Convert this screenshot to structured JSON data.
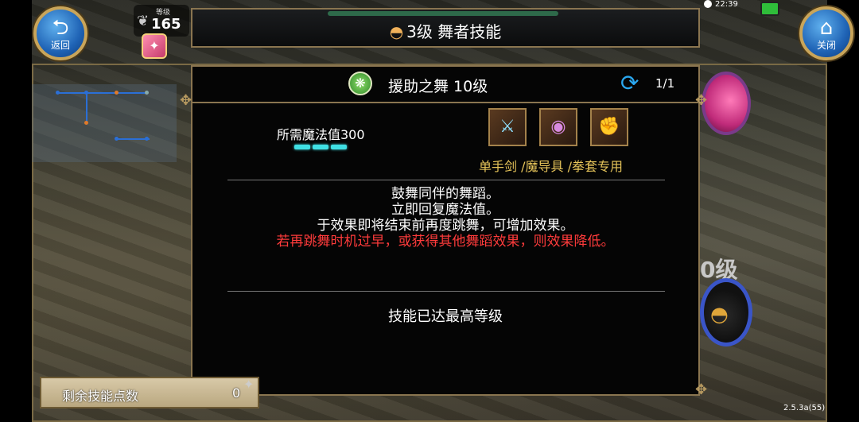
{
  "nav": {
    "back_label": "返回",
    "close_label": "关闭",
    "back_glyph": "⮌",
    "close_glyph": "⌂"
  },
  "player": {
    "level_caption": "等级",
    "level": "165",
    "other_count": "0"
  },
  "header": {
    "title": "3级 舞者技能"
  },
  "status": {
    "time": "22:39"
  },
  "skill": {
    "name": "援助之舞 10级",
    "page": "1/1",
    "mana_label": "所需魔法值300",
    "mana_segments": 3,
    "weapons": [
      "sword-icon",
      "magic-tool-icon",
      "knuckle-icon"
    ],
    "weapon_caption": "单手剑 /魔导具 /拳套专用",
    "description": [
      "鼓舞同伴的舞蹈。",
      "立即回复魔法值。",
      "于效果即将结束前再度跳舞，可增加效果。"
    ],
    "warning": "若再跳舞时机过早，或获得其他舞蹈效果，则效果降低。",
    "maxed_text": "技能已达最高等级"
  },
  "side": {
    "level_text": "0级"
  },
  "skill_points": {
    "label": "剩余技能点数",
    "value": "0"
  },
  "footer": {
    "version": "2.5.3a(55)"
  },
  "colors": {
    "warning": "#ff3b3b",
    "caption": "#e7c55a",
    "mana": "#3fe0e4",
    "frame": "#8a7550"
  }
}
